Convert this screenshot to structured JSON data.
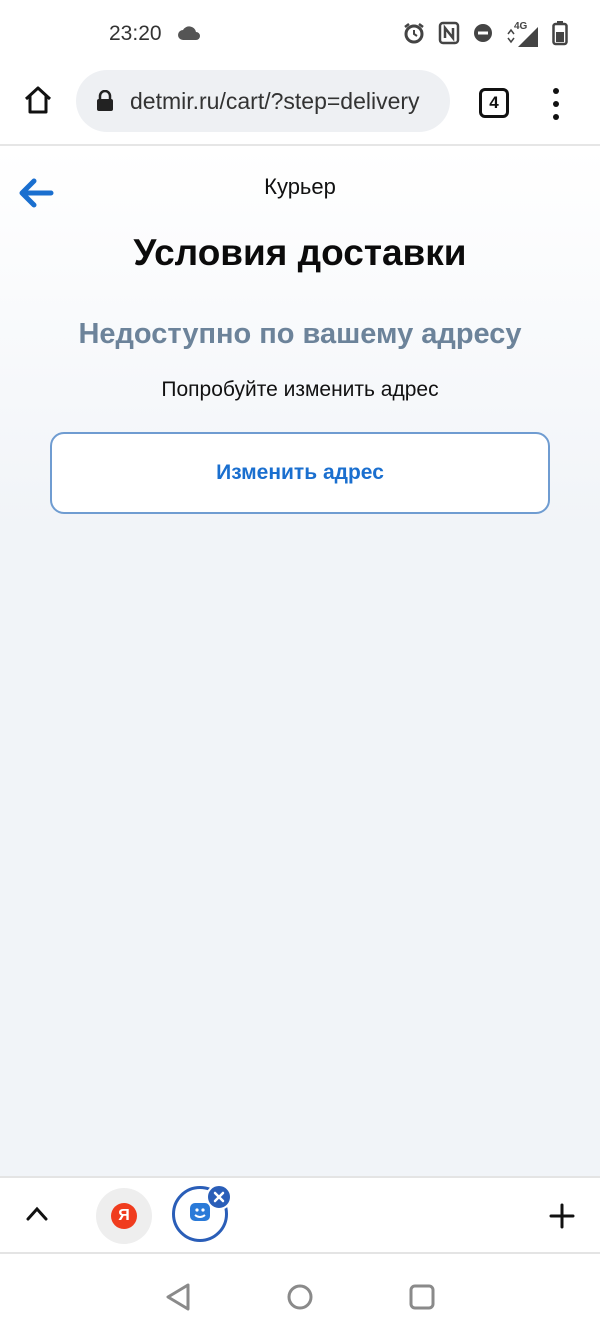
{
  "status_bar": {
    "time": "23:20",
    "network": "4G",
    "icons": [
      "cloud-icon",
      "alarm-icon",
      "nfc-icon",
      "dnd-icon",
      "signal-icon",
      "battery-icon"
    ]
  },
  "browser": {
    "url": "detmir.ru/cart/?step=delivery",
    "tab_count": "4",
    "icons": [
      "home-icon",
      "lock-icon",
      "more-icon"
    ]
  },
  "page": {
    "breadcrumb": "Курьер",
    "title": "Условия доставки",
    "subtitle": "Недоступно по вашему адресу",
    "hint": "Попробуйте изменить адрес",
    "change_button": "Изменить адрес"
  },
  "bottom_bar": {
    "yandex_label": "Я",
    "icons": [
      "chevron-up-icon",
      "yandex-icon",
      "detmir-icon",
      "close-icon",
      "plus-icon"
    ]
  },
  "colors": {
    "accent": "#1a6fcf",
    "subtitle": "#6c839a",
    "button_border": "#6f9cd1",
    "tab_blue": "#2a5eb8"
  }
}
